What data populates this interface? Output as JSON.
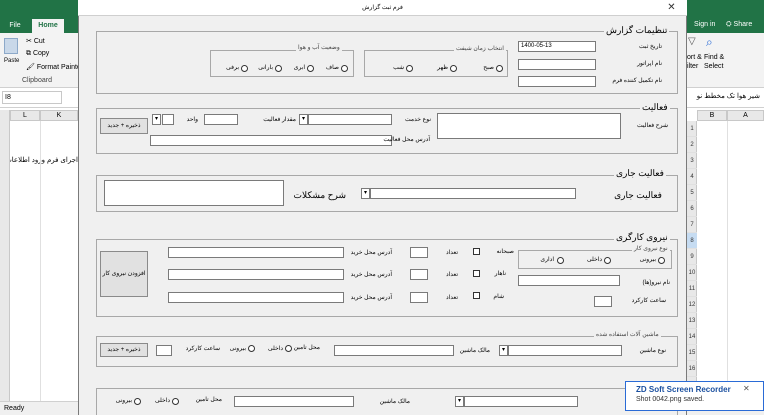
{
  "excel": {
    "tabs": [
      "File",
      "Home"
    ],
    "signin": "Sign in",
    "share": "Share",
    "clipboard": {
      "paste": "Paste",
      "cut": "Cut",
      "copy": "Copy",
      "format_painter": "Format Painter",
      "group": "Clipboard"
    },
    "find": {
      "sort": "ort &",
      "filter": "ilter",
      "find_select": "Find &",
      "select": "Select"
    },
    "namebox": "I8",
    "formula_value": "شیر هوا تک مخطط نو",
    "columns_left": [
      "L",
      "K"
    ],
    "columns_right": [
      "B",
      "A"
    ],
    "cell_text": "اجرای فرم ورود اطلاعات",
    "rows": [
      "1",
      "2",
      "3",
      "4",
      "5",
      "6",
      "7",
      "8",
      "9",
      "10",
      "11",
      "12",
      "13",
      "14",
      "15",
      "16"
    ],
    "status": "Ready"
  },
  "form": {
    "title": "فرم ثبت گزارش",
    "report_settings": {
      "caption": "تنظیمات گزارش",
      "date_label": "تاریخ ثبت",
      "date_value": "1400-05-13",
      "operator_label": "نام اپراتور",
      "filler_label": "نام تکمیل کننده فرم",
      "shift": {
        "caption": "انتخاب زمان شیفت",
        "options": [
          "صبح",
          "ظهر",
          "شب"
        ]
      },
      "weather": {
        "caption": "وضعیت آب و هوا",
        "options": [
          "صاف",
          "ابری",
          "بارانی",
          "برفی"
        ]
      }
    },
    "activity": {
      "caption": "فعالیت",
      "desc_label": "شرح فعالیت",
      "service_type_label": "نوع خدمت",
      "amount_label": "مقدار فعالیت",
      "unit_label": "واحد",
      "location_label": "آدرس محل فعالیت",
      "save_new": "ذخیره + جدید"
    },
    "current_activity": {
      "caption": "فعالیت جاری",
      "label": "فعالیت جاری",
      "problems_label": "شرح مشکلات"
    },
    "workforce": {
      "caption": "نیروی کارگری",
      "type": {
        "caption": "نوع نیروی کار",
        "options": [
          "بیرونی",
          "داخلی",
          "اداری"
        ]
      },
      "names_label": "نام نیرو(ها)",
      "hours_label": "ساعت کارکرد",
      "shifts": [
        "صبحانه",
        "ناهار",
        "شام"
      ],
      "count_label": "تعداد",
      "address_label": "آدرس محل خرید",
      "add_button": "افزودن نیروی کار"
    },
    "machines": {
      "caption": "ماشین آلات استفاده شده",
      "type_label": "نوع ماشین",
      "owner_label": "مالک ماشین",
      "supply_label": "محل تامین",
      "supply_options": [
        "داخلی",
        "بیرونی"
      ],
      "hours_label": "ساعت کارکرد",
      "save_new": "ذخیره + جدید"
    },
    "bottom": {
      "owner_label": "مالک ماشین",
      "supply_label": "محل تامین",
      "supply_options": [
        "داخلی",
        "بیرونی"
      ]
    }
  },
  "toast": {
    "title": "ZD Soft Screen Recorder",
    "message": "Shot 0042.png saved."
  }
}
